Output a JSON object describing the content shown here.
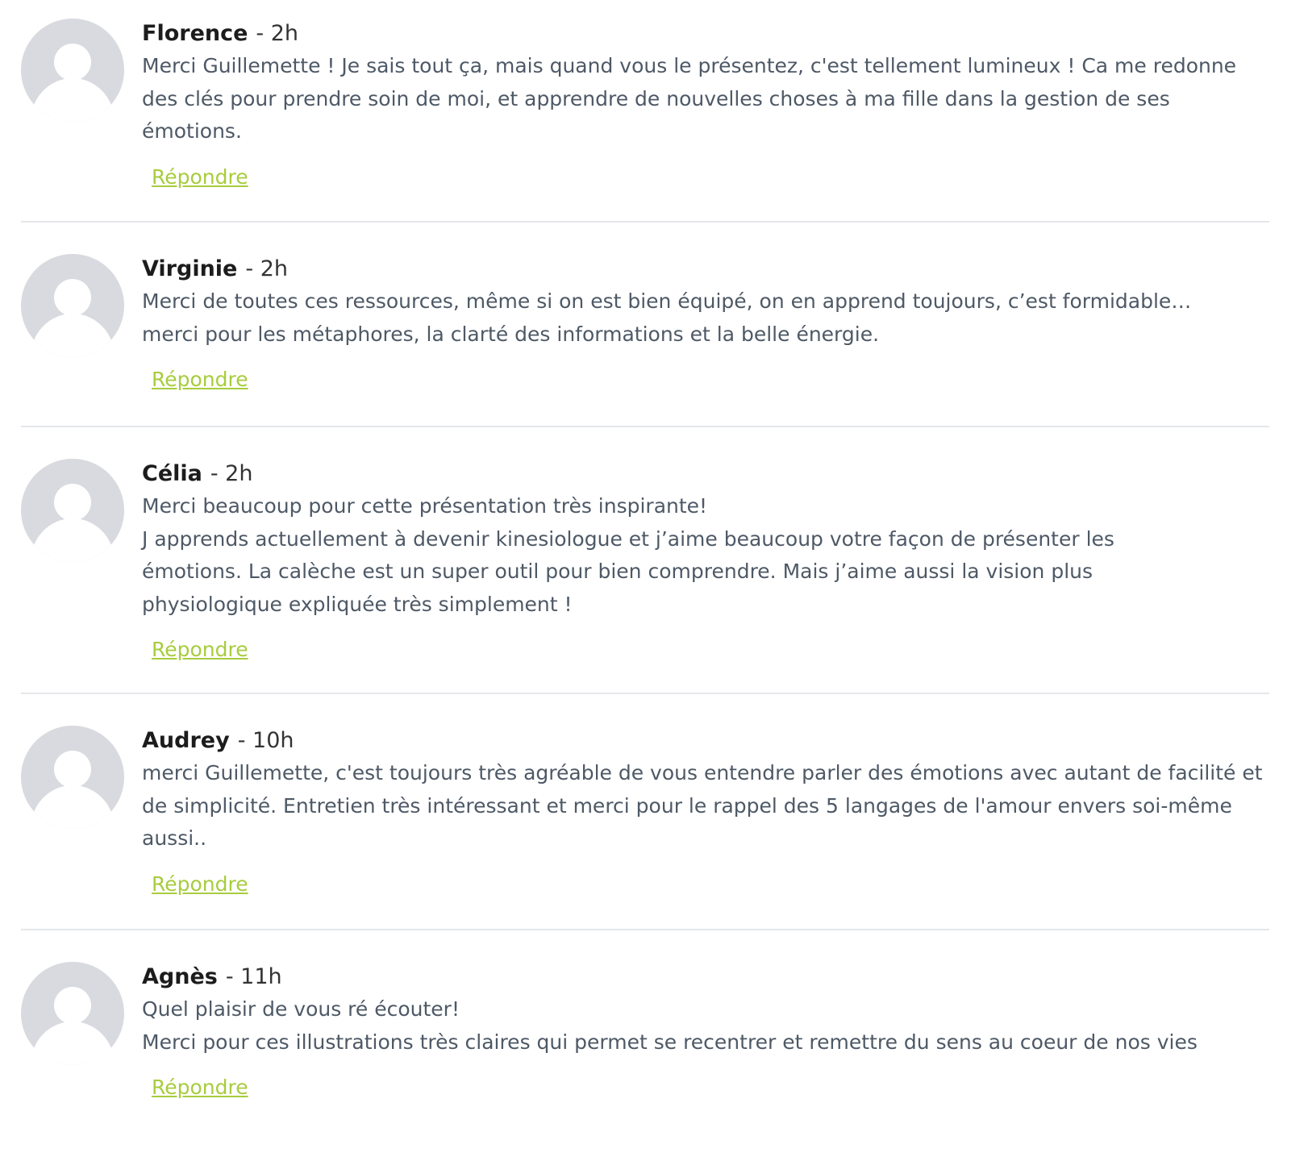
{
  "comments": [
    {
      "author": "Florence",
      "time": "- 2h",
      "body": "Merci Guillemette ! Je sais tout ça, mais quand vous le présentez, c'est tellement lumineux ! Ca me redonne des clés pour prendre soin de moi, et apprendre de nouvelles choses à ma fille dans la gestion de ses émotions.",
      "reply_label": "Répondre"
    },
    {
      "author": "Virginie",
      "time": "- 2h",
      "body": "Merci de toutes ces ressources, même si on est bien équipé, on en apprend toujours, c’est formidable… merci pour les métaphores, la clarté des informations et la belle énergie.",
      "reply_label": "Répondre"
    },
    {
      "author": "Célia",
      "time": "- 2h",
      "body": "Merci beaucoup pour cette présentation très inspirante!\nJ apprends actuellement à devenir kinesiologue et j’aime beaucoup votre façon de présenter les émotions. La calèche est un super outil pour bien comprendre. Mais j’aime aussi la vision plus physiologique expliquée très simplement !",
      "reply_label": "Répondre"
    },
    {
      "author": "Audrey",
      "time": "- 10h",
      "body": "merci Guillemette, c'est toujours très agréable de vous entendre parler des émotions avec autant de facilité et de simplicité. Entretien très intéressant et merci pour le rappel des 5 langages de l'amour envers soi-même aussi..",
      "reply_label": "Répondre"
    },
    {
      "author": "Agnès",
      "time": "- 11h",
      "body": "Quel plaisir de vous ré écouter!\nMerci pour ces illustrations très claires qui permet se recentrer et remettre du sens au coeur de nos vies",
      "reply_label": "Répondre"
    }
  ],
  "avatar_icon": "default-user-avatar-icon",
  "colors": {
    "author": "#1c1c1c",
    "body_text": "#4e5966",
    "reply_link": "#a8cc3e",
    "divider": "#e4e6ea",
    "avatar_bg": "#d8dadf",
    "avatar_silhouette": "#ffffff"
  }
}
